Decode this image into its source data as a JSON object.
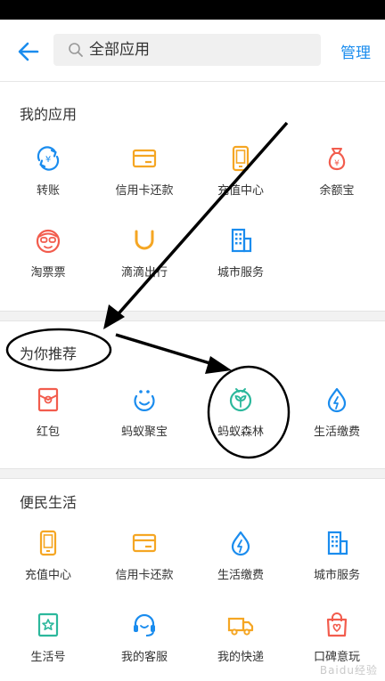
{
  "header": {
    "search_placeholder": "全部应用",
    "manage_label": "管理"
  },
  "my_apps": {
    "title": "我的应用",
    "items": [
      {
        "label": "转账",
        "icon": "transfer-icon"
      },
      {
        "label": "信用卡还款",
        "icon": "credit-card-icon"
      },
      {
        "label": "充值中心",
        "icon": "phone-icon"
      },
      {
        "label": "余额宝",
        "icon": "money-bag-icon"
      },
      {
        "label": "淘票票",
        "icon": "ticket-face-icon"
      },
      {
        "label": "滴滴出行",
        "icon": "didi-icon"
      },
      {
        "label": "城市服务",
        "icon": "building-icon"
      }
    ]
  },
  "recommended": {
    "title": "为你推荐",
    "items": [
      {
        "label": "红包",
        "icon": "red-packet-icon"
      },
      {
        "label": "蚂蚁聚宝",
        "icon": "smile-icon"
      },
      {
        "label": "蚂蚁森林",
        "icon": "sprout-icon"
      },
      {
        "label": "生活缴费",
        "icon": "water-drop-icon"
      }
    ]
  },
  "convenience": {
    "title": "便民生活",
    "items": [
      {
        "label": "充值中心",
        "icon": "phone-icon"
      },
      {
        "label": "信用卡还款",
        "icon": "credit-card-icon"
      },
      {
        "label": "生活缴费",
        "icon": "water-drop-icon"
      },
      {
        "label": "城市服务",
        "icon": "building-icon"
      },
      {
        "label": "生活号",
        "icon": "star-card-icon"
      },
      {
        "label": "我的客服",
        "icon": "headset-icon"
      },
      {
        "label": "我的快递",
        "icon": "truck-icon"
      },
      {
        "label": "口碑意玩",
        "icon": "gift-bag-icon"
      }
    ]
  },
  "watermark": "Baidu经验",
  "colors": {
    "blue": "#1a8cee",
    "orange": "#f5a623",
    "red": "#f25c4d",
    "teal": "#2cb89c",
    "annotation": "#000000"
  }
}
